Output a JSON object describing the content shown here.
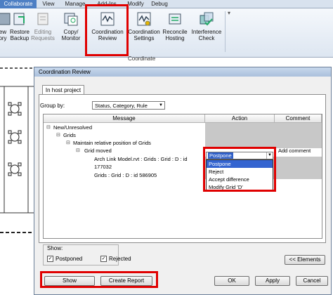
{
  "ribbon": {
    "tabs": [
      "Collaborate",
      "View",
      "Manage",
      "Add-Ins",
      "Modify",
      "Debug"
    ],
    "buttons": [
      {
        "label": "ew\nory",
        "icon": "view-history-icon"
      },
      {
        "label": "Restore\nBackup",
        "icon": "restore-backup-icon"
      },
      {
        "label": "Editing\nRequests",
        "icon": "editing-requests-icon"
      },
      {
        "label": "Copy/\nMonitor",
        "icon": "copy-monitor-icon"
      },
      {
        "label": "Coordination\nReview",
        "icon": "coordination-review-icon"
      },
      {
        "label": "Coordination\nSettings",
        "icon": "coordination-settings-icon"
      },
      {
        "label": "Reconcile\nHosting",
        "icon": "reconcile-hosting-icon"
      },
      {
        "label": "Interference\nCheck",
        "icon": "interference-check-icon"
      }
    ],
    "panel_title": "Coordinate"
  },
  "dialog": {
    "title": "Coordination Review",
    "tab": "In host project",
    "group_by_label": "Group by:",
    "group_by_value": "Status, Category, Rule",
    "columns": {
      "message": "Message",
      "action": "Action",
      "comment": "Comment"
    },
    "tree": {
      "n1": "New/Unresolved",
      "n2": "Grids",
      "n3": "Maintain relative position of Grids",
      "n4": "Grid moved",
      "n5a": "Arch Link Model.rvt : Grids : Grid : D : id",
      "n5b": "177032",
      "n6": "Grids : Grid : D : id 586905"
    },
    "action_value": "Postpone",
    "add_comment": "Add comment",
    "dropdown_options": [
      "Postpone",
      "Reject",
      "Accept difference",
      "Modify Grid 'D'"
    ],
    "show_label": "Show:",
    "postponed": "Postponed",
    "rejected": "Rejected",
    "elements_button": "<< Elements",
    "show_button": "Show",
    "create_report_button": "Create Report",
    "ok_button": "OK",
    "apply_button": "Apply",
    "cancel_button": "Cancel"
  }
}
